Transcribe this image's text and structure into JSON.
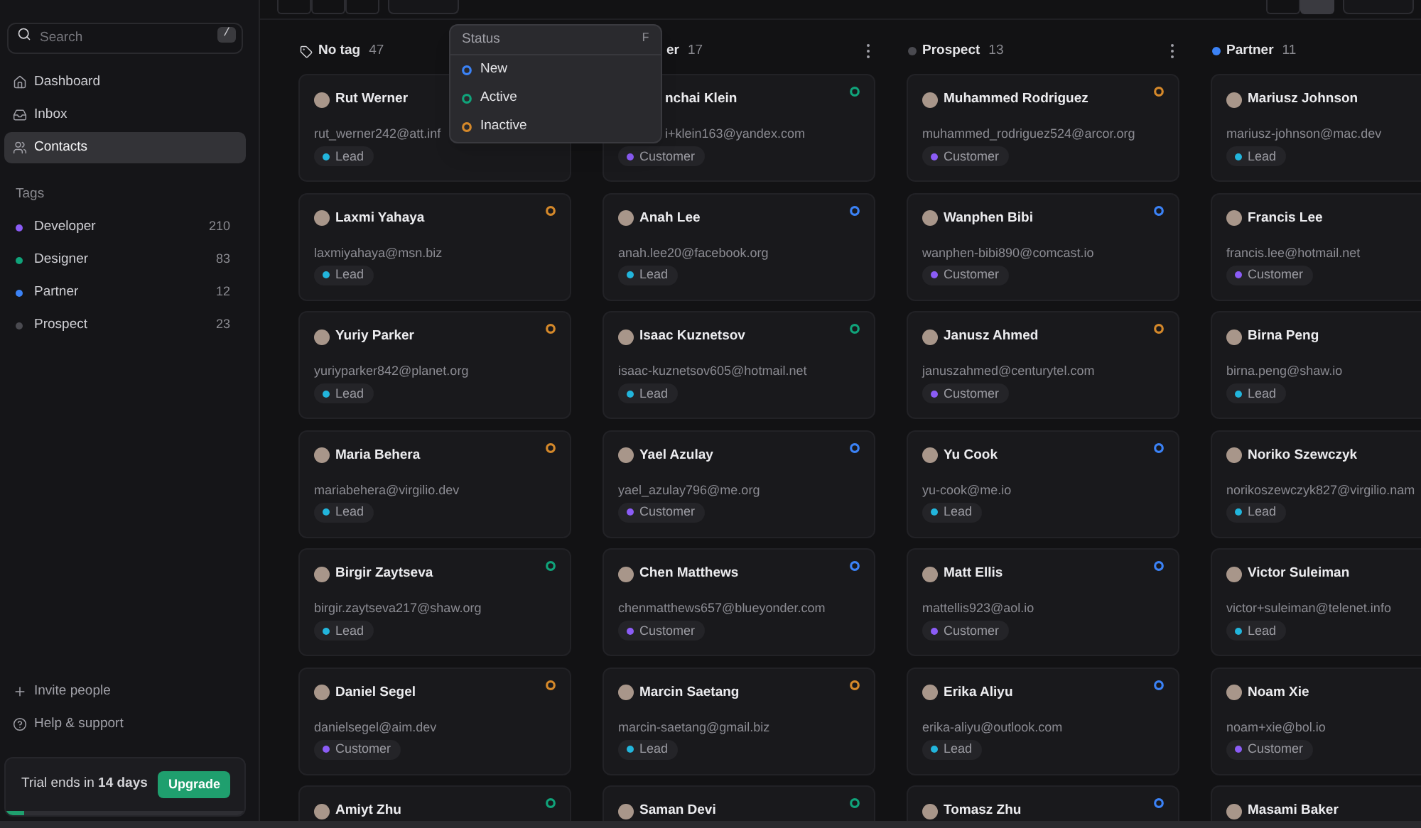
{
  "sidebar": {
    "search": {
      "placeholder": "Search",
      "shortcut": "/"
    },
    "nav": [
      {
        "label": "Dashboard",
        "selected": false
      },
      {
        "label": "Inbox",
        "selected": false
      },
      {
        "label": "Contacts",
        "selected": true
      }
    ],
    "tags_heading": "Tags",
    "tags": [
      {
        "label": "Developer",
        "count": "210",
        "color": "#8b5cf6"
      },
      {
        "label": "Designer",
        "count": "83",
        "color": "#10a37a"
      },
      {
        "label": "Partner",
        "count": "12",
        "color": "#3b82f6"
      },
      {
        "label": "Prospect",
        "count": "23",
        "color": "#4a4a50"
      }
    ],
    "links": [
      {
        "label": "Invite people"
      },
      {
        "label": "Help & support"
      }
    ],
    "trial": {
      "text": "Trial ends in **14 days**",
      "button": "Upgrade",
      "level": 0.08
    }
  },
  "toolbar": {
    "left": [
      {
        "kind": "segment",
        "selected": false
      },
      {
        "kind": "segment",
        "selected": false
      },
      {
        "kind": "segment",
        "selected": false
      },
      {
        "kind": "button"
      }
    ],
    "right": [
      {
        "kind": "segment",
        "selected": false
      },
      {
        "kind": "segment",
        "selected": true
      },
      {
        "kind": "button"
      }
    ]
  },
  "status_menu": {
    "title": "Status",
    "shortcut": "F",
    "items": [
      {
        "label": "New",
        "color": "#3b82f6"
      },
      {
        "label": "Active",
        "color": "#10a37a"
      },
      {
        "label": "Inactive",
        "color": "#d4882a"
      }
    ]
  },
  "board": {
    "columns": [
      {
        "kind": "tag",
        "title": "No tag",
        "count": "47",
        "cards": [
          {
            "name": "Rut Werner",
            "email": "rut_werner242@att.inf",
            "tag": {
              "label": "Lead",
              "color": "#22b5dc"
            }
          },
          {
            "name": "Laxmi Yahaya",
            "email": "laxmiyahaya@msn.biz",
            "color": "#d4882a",
            "tag": {
              "label": "Lead",
              "color": "#22b5dc"
            }
          },
          {
            "name": "Yuriy Parker",
            "email": "yuriyparker842@planet.org",
            "color": "#d4882a",
            "tag": {
              "label": "Lead",
              "color": "#22b5dc"
            }
          },
          {
            "name": "Maria Behera",
            "email": "mariabehera@virgilio.dev",
            "color": "#d4882a",
            "tag": {
              "label": "Lead",
              "color": "#22b5dc"
            }
          },
          {
            "name": "Birgir Zaytseva",
            "email": "birgir.zaytseva217@shaw.org",
            "color": "#10a37a",
            "tag": {
              "label": "Lead",
              "color": "#22b5dc"
            }
          },
          {
            "name": "Daniel Segel",
            "email": "danielsegel@aim.dev",
            "color": "#d4882a",
            "tag": {
              "label": "Customer",
              "color": "#8b5cf6"
            }
          },
          {
            "name": "Amiyt Zhu",
            "color": "#10a37a"
          }
        ]
      },
      {
        "kind": "covered",
        "title": "er",
        "count": "17",
        "more_button": true,
        "cards": [
          {
            "covered_by_menu": true,
            "name": "nchai Klein",
            "email": "i+klein163@yandex.com",
            "color": "#10a37a",
            "tag": {
              "label": "Customer",
              "color": "#8b5cf6"
            }
          },
          {
            "name": "Anah Lee",
            "email": "anah.lee20@facebook.org",
            "color": "#3b82f6",
            "tag": {
              "label": "Lead",
              "color": "#22b5dc"
            }
          },
          {
            "name": "Isaac Kuznetsov",
            "email": "isaac-kuznetsov605@hotmail.net",
            "color": "#10a37a",
            "tag": {
              "label": "Lead",
              "color": "#22b5dc"
            }
          },
          {
            "name": "Yael Azulay",
            "email": "yael_azulay796@me.org",
            "color": "#3b82f6",
            "tag": {
              "label": "Customer",
              "color": "#8b5cf6"
            }
          },
          {
            "name": "Chen Matthews",
            "email": "chenmatthews657@blueyonder.com",
            "color": "#3b82f6",
            "tag": {
              "label": "Customer",
              "color": "#8b5cf6"
            }
          },
          {
            "name": "Marcin Saetang",
            "email": "marcin-saetang@gmail.biz",
            "color": "#d4882a",
            "tag": {
              "label": "Lead",
              "color": "#22b5dc"
            }
          },
          {
            "name": "Saman Devi",
            "color": "#10a37a"
          }
        ]
      },
      {
        "kind": "dot",
        "color": "#4a4a50",
        "title": "Prospect",
        "count": "13",
        "more_button": true,
        "cards": [
          {
            "name": "Muhammed Rodriguez",
            "email": "muhammed_rodriguez524@arcor.org",
            "color": "#d4882a",
            "tag": {
              "label": "Customer",
              "color": "#8b5cf6"
            }
          },
          {
            "name": "Wanphen Bibi",
            "email": "wanphen-bibi890@comcast.io",
            "color": "#3b82f6",
            "tag": {
              "label": "Customer",
              "color": "#8b5cf6"
            }
          },
          {
            "name": "Janusz Ahmed",
            "email": "januszahmed@centurytel.com",
            "color": "#d4882a",
            "tag": {
              "label": "Customer",
              "color": "#8b5cf6"
            }
          },
          {
            "name": "Yu Cook",
            "email": "yu-cook@me.io",
            "color": "#3b82f6",
            "tag": {
              "label": "Lead",
              "color": "#22b5dc"
            }
          },
          {
            "name": "Matt Ellis",
            "email": "mattellis923@aol.io",
            "color": "#3b82f6",
            "tag": {
              "label": "Customer",
              "color": "#8b5cf6"
            }
          },
          {
            "name": "Erika Aliyu",
            "email": "erika-aliyu@outlook.com",
            "color": "#3b82f6",
            "tag": {
              "label": "Lead",
              "color": "#22b5dc"
            }
          },
          {
            "name": "Tomasz Zhu",
            "color": "#3b82f6"
          }
        ]
      },
      {
        "kind": "dot",
        "color": "#3b82f6",
        "title": "Partner",
        "count": "11",
        "cards": [
          {
            "name": "Mariusz Johnson",
            "email": "mariusz-johnson@mac.dev",
            "tag": {
              "label": "Lead",
              "color": "#22b5dc"
            }
          },
          {
            "name": "Francis Lee",
            "email": "francis.lee@hotmail.net",
            "tag": {
              "label": "Customer",
              "color": "#8b5cf6"
            }
          },
          {
            "name": "Birna Peng",
            "email": "birna.peng@shaw.io",
            "tag": {
              "label": "Lead",
              "color": "#22b5dc"
            }
          },
          {
            "name": "Noriko Szewczyk",
            "email": "norikoszewczyk827@virgilio.nam",
            "tag": {
              "label": "Lead",
              "color": "#22b5dc"
            }
          },
          {
            "name": "Victor Suleiman",
            "email": "victor+suleiman@telenet.info",
            "tag": {
              "label": "Lead",
              "color": "#22b5dc"
            }
          },
          {
            "name": "Noam Xie",
            "email": "noam+xie@bol.io",
            "tag": {
              "label": "Customer",
              "color": "#8b5cf6"
            }
          },
          {
            "name": "Masami Baker"
          }
        ]
      }
    ]
  }
}
